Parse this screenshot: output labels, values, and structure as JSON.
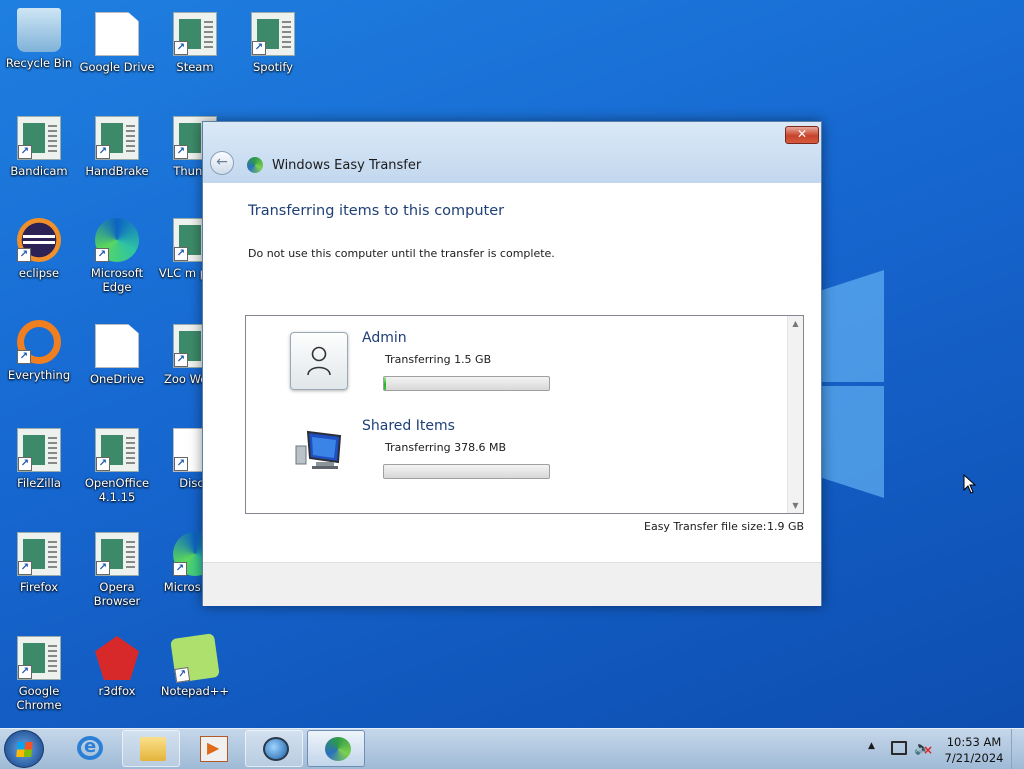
{
  "desktop": {
    "icons": [
      {
        "label": "Recycle Bin"
      },
      {
        "label": "Google Drive"
      },
      {
        "label": "Steam"
      },
      {
        "label": "Spotify"
      },
      {
        "label": "Bandicam"
      },
      {
        "label": "HandBrake"
      },
      {
        "label": "Thunde"
      },
      {
        "label": "eclipse"
      },
      {
        "label": "Microsoft Edge"
      },
      {
        "label": "VLC m playe"
      },
      {
        "label": "Everything"
      },
      {
        "label": "OneDrive"
      },
      {
        "label": "Zoo Workp"
      },
      {
        "label": "FileZilla"
      },
      {
        "label": "OpenOffice 4.1.15"
      },
      {
        "label": "Disco"
      },
      {
        "label": "Firefox"
      },
      {
        "label": "Opera Browser"
      },
      {
        "label": "Micros Edg"
      },
      {
        "label": "Google Chrome"
      },
      {
        "label": "r3dfox"
      },
      {
        "label": "Notepad++"
      }
    ]
  },
  "window": {
    "title": "Windows Easy Transfer",
    "close_symbol": "✕",
    "back_symbol": "←",
    "heading": "Transferring items to this computer",
    "subtext": "Do not use this computer until the transfer is complete.",
    "items": [
      {
        "name": "Admin",
        "status": "Transferring 1.5 GB",
        "progress_percent": 1.5
      },
      {
        "name": "Shared Items",
        "status": "Transferring 378.6 MB",
        "progress_percent": 0
      }
    ],
    "file_size_label": "Easy Transfer file size:",
    "file_size_value": "1.9 GB"
  },
  "taskbar": {
    "clock_time": "10:53 AM",
    "clock_date": "7/21/2024",
    "tray_arrow": "▲"
  },
  "colors": {
    "heading": "#1e3f77",
    "progress_fill": "#29b22b",
    "desktop_bg": "#1666cf"
  }
}
